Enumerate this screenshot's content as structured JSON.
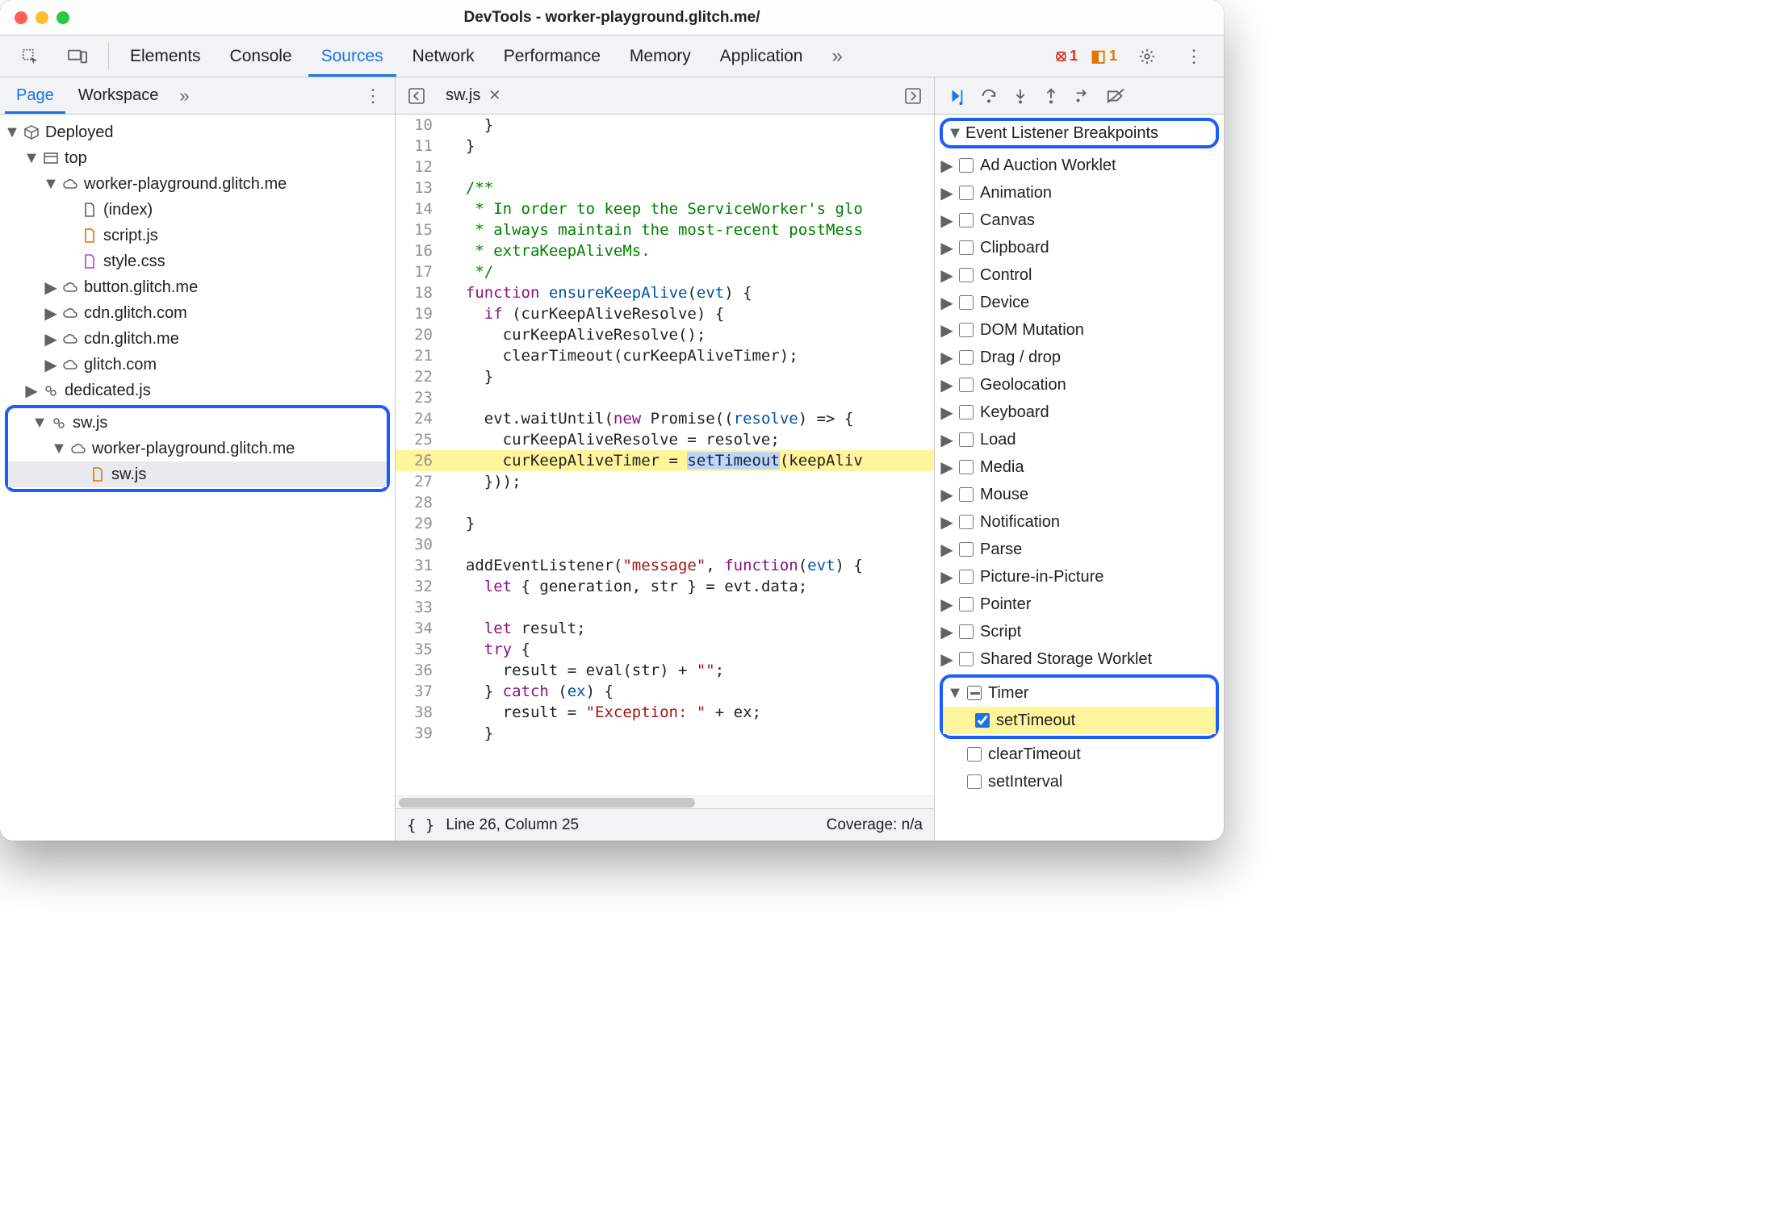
{
  "window_title": "DevTools - worker-playground.glitch.me/",
  "top_tabs": [
    "Elements",
    "Console",
    "Sources",
    "Network",
    "Performance",
    "Memory",
    "Application"
  ],
  "top_active": "Sources",
  "errors": {
    "error_count": "1",
    "warn_count": "1"
  },
  "left": {
    "tabs": [
      "Page",
      "Workspace"
    ],
    "active": "Page",
    "tree": [
      {
        "depth": 0,
        "arrow": "down",
        "icon": "box",
        "label": "Deployed"
      },
      {
        "depth": 1,
        "arrow": "down",
        "icon": "frame",
        "label": "top"
      },
      {
        "depth": 2,
        "arrow": "down",
        "icon": "cloud",
        "label": "worker-playground.glitch.me"
      },
      {
        "depth": 3,
        "arrow": "",
        "icon": "doc",
        "label": "(index)"
      },
      {
        "depth": 3,
        "arrow": "",
        "icon": "js",
        "label": "script.js"
      },
      {
        "depth": 3,
        "arrow": "",
        "icon": "css",
        "label": "style.css"
      },
      {
        "depth": 2,
        "arrow": "right",
        "icon": "cloud",
        "label": "button.glitch.me"
      },
      {
        "depth": 2,
        "arrow": "right",
        "icon": "cloud",
        "label": "cdn.glitch.com"
      },
      {
        "depth": 2,
        "arrow": "right",
        "icon": "cloud",
        "label": "cdn.glitch.me"
      },
      {
        "depth": 2,
        "arrow": "right",
        "icon": "cloud",
        "label": "glitch.com"
      },
      {
        "depth": 1,
        "arrow": "right",
        "icon": "gears",
        "label": "dedicated.js"
      }
    ],
    "tree_ringed": [
      {
        "depth": 1,
        "arrow": "down",
        "icon": "gears",
        "label": "sw.js"
      },
      {
        "depth": 2,
        "arrow": "down",
        "icon": "cloud",
        "label": "worker-playground.glitch.me"
      },
      {
        "depth": 3,
        "arrow": "",
        "icon": "js",
        "label": "sw.js",
        "selected": true
      }
    ]
  },
  "editor": {
    "open_file": "sw.js",
    "status_line": "Line 26, Column 25",
    "coverage": "Coverage: n/a",
    "highlight_line": 26,
    "lines": [
      {
        "n": 10,
        "html": "    }"
      },
      {
        "n": 11,
        "html": "  }"
      },
      {
        "n": 12,
        "html": ""
      },
      {
        "n": 13,
        "html": "  <span class='c-cmt'>/**</span>"
      },
      {
        "n": 14,
        "html": "  <span class='c-cmt'> * In order to keep the ServiceWorker's glo</span>"
      },
      {
        "n": 15,
        "html": "  <span class='c-cmt'> * always maintain the most-recent postMess</span>"
      },
      {
        "n": 16,
        "html": "  <span class='c-cmt'> * extraKeepAliveMs.</span>"
      },
      {
        "n": 17,
        "html": "  <span class='c-cmt'> */</span>"
      },
      {
        "n": 18,
        "html": "  <span class='c-kw'>function</span> <span class='c-id'>ensureKeepAlive</span>(<span class='c-id'>evt</span>) {"
      },
      {
        "n": 19,
        "html": "    <span class='c-kw'>if</span> (curKeepAliveResolve) {"
      },
      {
        "n": 20,
        "html": "      curKeepAliveResolve();"
      },
      {
        "n": 21,
        "html": "      clearTimeout(curKeepAliveTimer);"
      },
      {
        "n": 22,
        "html": "    }"
      },
      {
        "n": 23,
        "html": ""
      },
      {
        "n": 24,
        "html": "    evt.waitUntil(<span class='c-kw'>new</span> Promise((<span class='c-id'>resolve</span>) => {"
      },
      {
        "n": 25,
        "html": "      curKeepAliveResolve = resolve;"
      },
      {
        "n": 26,
        "html": "      curKeepAliveTimer = <span style='background:#bcd6ff'>setTimeout</span>(keepAliv"
      },
      {
        "n": 27,
        "html": "    }));"
      },
      {
        "n": 28,
        "html": ""
      },
      {
        "n": 29,
        "html": "  }"
      },
      {
        "n": 30,
        "html": ""
      },
      {
        "n": 31,
        "html": "  addEventListener(<span class='c-str'>\"message\"</span>, <span class='c-kw'>function</span>(<span class='c-id'>evt</span>) {"
      },
      {
        "n": 32,
        "html": "    <span class='c-kw'>let</span> { generation, str } = evt.data;"
      },
      {
        "n": 33,
        "html": ""
      },
      {
        "n": 34,
        "html": "    <span class='c-kw'>let</span> result;"
      },
      {
        "n": 35,
        "html": "    <span class='c-kw'>try</span> {"
      },
      {
        "n": 36,
        "html": "      result = eval(str) + <span class='c-str'>\"\"</span>;"
      },
      {
        "n": 37,
        "html": "    } <span class='c-kw'>catch</span> (<span class='c-id'>ex</span>) {"
      },
      {
        "n": 38,
        "html": "      result = <span class='c-str'>\"Exception: \"</span> + ex;"
      },
      {
        "n": 39,
        "html": "    }"
      }
    ]
  },
  "breakpoints": {
    "section_title": "Event Listener Breakpoints",
    "categories": [
      {
        "label": "Ad Auction Worklet"
      },
      {
        "label": "Animation"
      },
      {
        "label": "Canvas"
      },
      {
        "label": "Clipboard"
      },
      {
        "label": "Control"
      },
      {
        "label": "Device"
      },
      {
        "label": "DOM Mutation"
      },
      {
        "label": "Drag / drop"
      },
      {
        "label": "Geolocation"
      },
      {
        "label": "Keyboard"
      },
      {
        "label": "Load"
      },
      {
        "label": "Media"
      },
      {
        "label": "Mouse"
      },
      {
        "label": "Notification"
      },
      {
        "label": "Parse"
      },
      {
        "label": "Picture-in-Picture"
      },
      {
        "label": "Pointer"
      },
      {
        "label": "Script"
      },
      {
        "label": "Shared Storage Worklet"
      }
    ],
    "timer_label": "Timer",
    "timer_children": [
      {
        "label": "setTimeout",
        "checked": true,
        "hl": true
      },
      {
        "label": "clearTimeout",
        "checked": false
      },
      {
        "label": "setInterval",
        "checked": false
      }
    ]
  }
}
